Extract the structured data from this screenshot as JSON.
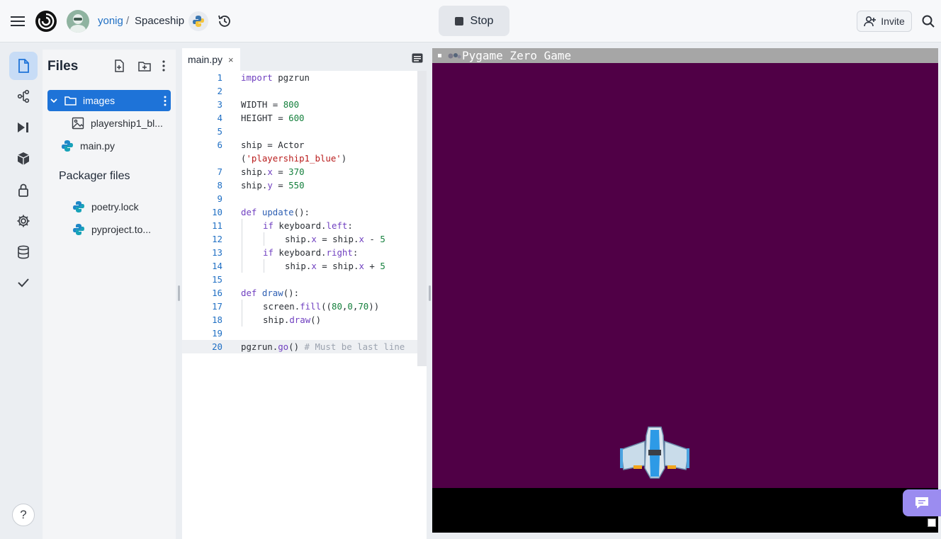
{
  "topbar": {
    "username": "yonig",
    "separator": "/",
    "repl_name": "Spaceship",
    "stop_label": "Stop",
    "invite_label": "Invite"
  },
  "icons": {
    "menu": "hamburger-icon",
    "logo": "replit-logo",
    "language": "python-icon",
    "history": "history-icon",
    "search": "search-icon"
  },
  "rail": {
    "items": [
      "files-icon",
      "git-icon",
      "run-icon",
      "packages-icon",
      "secrets-icon",
      "settings-icon",
      "database-icon",
      "tests-icon"
    ],
    "help_label": "?"
  },
  "files": {
    "title": "Files",
    "tree": [
      {
        "name": "images",
        "type": "folder",
        "expanded": true,
        "selected": true
      },
      {
        "name": "playership1_bl...",
        "type": "image"
      },
      {
        "name": "main.py",
        "type": "python"
      }
    ],
    "packager_title": "Packager files",
    "packager_items": [
      "poetry.lock",
      "pyproject.to..."
    ]
  },
  "editor": {
    "tab_label": "main.py",
    "tab_close": "×",
    "current_line": 20,
    "lines": [
      {
        "n": "1",
        "t": "import pgzrun"
      },
      {
        "n": "2",
        "t": ""
      },
      {
        "n": "3",
        "t": "WIDTH = 800"
      },
      {
        "n": "4",
        "t": "HEIGHT = 600"
      },
      {
        "n": "5",
        "t": ""
      },
      {
        "n": "6",
        "t": "ship = Actor"
      },
      {
        "n": "",
        "t": "('playership1_blue')"
      },
      {
        "n": "7",
        "t": "ship.x = 370"
      },
      {
        "n": "8",
        "t": "ship.y = 550"
      },
      {
        "n": "9",
        "t": ""
      },
      {
        "n": "10",
        "t": "def update():"
      },
      {
        "n": "11",
        "t": "if keyboard.left:"
      },
      {
        "n": "12",
        "t": "ship.x = ship.x - 5"
      },
      {
        "n": "13",
        "t": "if keyboard.right:"
      },
      {
        "n": "14",
        "t": "ship.x = ship.x + 5"
      },
      {
        "n": "15",
        "t": ""
      },
      {
        "n": "16",
        "t": "def draw():"
      },
      {
        "n": "17",
        "t": "screen.fill((80,0,70))"
      },
      {
        "n": "18",
        "t": "ship.draw()"
      },
      {
        "n": "19",
        "t": ""
      },
      {
        "n": "20",
        "t": "pgzrun.go() # Must be last line"
      }
    ]
  },
  "game": {
    "window_title": "Pygame Zero Game",
    "background_color": "#500046"
  },
  "colors": {
    "accent": "#1e73d8",
    "chat_button": "#9b8cf0"
  }
}
